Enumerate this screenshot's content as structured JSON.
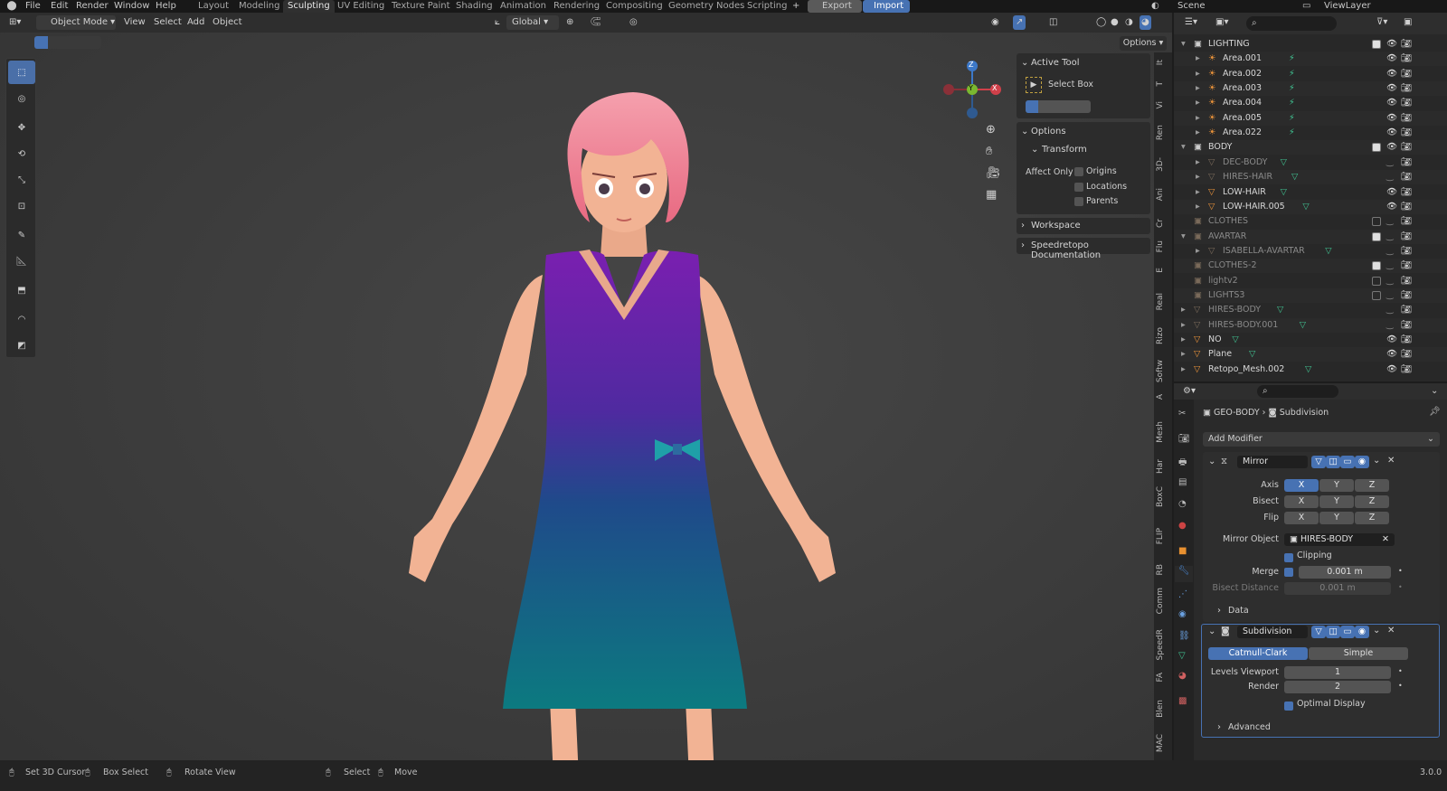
{
  "topbar": {
    "menus": [
      "File",
      "Edit",
      "Render",
      "Window",
      "Help"
    ],
    "workspaces": [
      "Layout",
      "Modeling",
      "Sculpting",
      "UV Editing",
      "Texture Paint",
      "Shading",
      "Animation",
      "Rendering",
      "Compositing",
      "Geometry Nodes",
      "Scripting"
    ],
    "active_workspace": "Sculpting",
    "add_tab": "+",
    "export_label": "Export",
    "import_label": "Import",
    "scene_label": "Scene",
    "viewlayer_label": "ViewLayer"
  },
  "viewport_header": {
    "mode": "Object Mode",
    "menus": [
      "View",
      "Select",
      "Add",
      "Object"
    ],
    "transform_orientation": "Global",
    "options_label": "Options"
  },
  "npanel": {
    "active_tool_title": "Active Tool",
    "tool_name": "Select Box",
    "options_title": "Options",
    "transform_title": "Transform",
    "affect_only_label": "Affect Only",
    "affect_options": [
      "Origins",
      "Locations",
      "Parents"
    ],
    "workspace_title": "Workspace",
    "speedretopo_title": "Speedretopo Documentation"
  },
  "sidebar_tabs": [
    "It",
    "T",
    "Vi",
    "Ren",
    "3D-",
    "Ani",
    "Cr",
    "Flu",
    "E",
    "Real",
    "Rizo",
    "Softw",
    "A",
    "Mesh",
    "Har",
    "BoxC",
    "FLIP",
    "RB",
    "Comm",
    "SpeedR",
    "FA",
    "Blen",
    "MAC"
  ],
  "gizmo": {
    "z": "Z",
    "y": "Y",
    "x": "X"
  },
  "outliner": {
    "rows": [
      {
        "name": "LIGHTING",
        "level": 1,
        "kind": "collection",
        "expanded": true,
        "checked": true,
        "visible": true
      },
      {
        "name": "Area.001",
        "level": 2,
        "kind": "light",
        "visible": true
      },
      {
        "name": "Area.002",
        "level": 2,
        "kind": "light",
        "visible": true
      },
      {
        "name": "Area.003",
        "level": 2,
        "kind": "light",
        "visible": true
      },
      {
        "name": "Area.004",
        "level": 2,
        "kind": "light",
        "visible": true
      },
      {
        "name": "Area.005",
        "level": 2,
        "kind": "light",
        "visible": true
      },
      {
        "name": "Area.022",
        "level": 2,
        "kind": "light",
        "visible": true
      },
      {
        "name": "BODY",
        "level": 1,
        "kind": "collection",
        "expanded": true,
        "checked": true,
        "visible": true
      },
      {
        "name": "DEC-BODY",
        "level": 2,
        "kind": "mesh",
        "visible": false
      },
      {
        "name": "HIRES-HAIR",
        "level": 2,
        "kind": "mesh",
        "visible": false
      },
      {
        "name": "LOW-HAIR",
        "level": 2,
        "kind": "mesh",
        "visible": true
      },
      {
        "name": "LOW-HAIR.005",
        "level": 2,
        "kind": "mesh",
        "visible": true
      },
      {
        "name": "CLOTHES",
        "level": 1,
        "kind": "collection",
        "checked": false,
        "visible": false
      },
      {
        "name": "AVARTAR",
        "level": 1,
        "kind": "collection",
        "expanded": true,
        "checked": true,
        "visible": false
      },
      {
        "name": "ISABELLA-AVARTAR",
        "level": 2,
        "kind": "mesh",
        "visible": false
      },
      {
        "name": "CLOTHES-2",
        "level": 1,
        "kind": "collection",
        "checked": true,
        "visible": false
      },
      {
        "name": "lightv2",
        "level": 1,
        "kind": "collection",
        "checked": false,
        "visible": false
      },
      {
        "name": "LIGHTS3",
        "level": 1,
        "kind": "collection",
        "checked": false,
        "visible": false
      },
      {
        "name": "HIRES-BODY",
        "level": 1,
        "kind": "mesh",
        "visible": false
      },
      {
        "name": "HIRES-BODY.001",
        "level": 1,
        "kind": "mesh",
        "visible": false
      },
      {
        "name": "NO",
        "level": 1,
        "kind": "mesh",
        "visible": true
      },
      {
        "name": "Plane",
        "level": 1,
        "kind": "mesh",
        "visible": true
      },
      {
        "name": "Retopo_Mesh.002",
        "level": 1,
        "kind": "mesh",
        "visible": true
      }
    ]
  },
  "properties": {
    "breadcrumb_object": "GEO-BODY",
    "breadcrumb_modifier": "Subdivision",
    "add_modifier": "Add Modifier",
    "mirror": {
      "name": "Mirror",
      "axis_label": "Axis",
      "bisect_label": "Bisect",
      "flip_label": "Flip",
      "axes": [
        "X",
        "Y",
        "Z"
      ],
      "mirror_object_label": "Mirror Object",
      "mirror_object": "HIRES-BODY",
      "clipping_label": "Clipping",
      "merge_label": "Merge",
      "merge_value": "0.001 m",
      "bisect_distance_label": "Bisect Distance",
      "bisect_distance_value": "0.001 m",
      "data_label": "Data"
    },
    "subdivision": {
      "name": "Subdivision",
      "method_active": "Catmull-Clark",
      "method_other": "Simple",
      "levels_viewport_label": "Levels Viewport",
      "levels_viewport": "1",
      "render_label": "Render",
      "render_value": "2",
      "optimal_display_label": "Optimal Display",
      "advanced_label": "Advanced"
    }
  },
  "statusbar": {
    "set_cursor": "Set 3D Cursor",
    "box_select": "Box Select",
    "rotate_view": "Rotate View",
    "select": "Select",
    "move": "Move",
    "version": "3.0.0"
  },
  "colors": {
    "accent": "#4772b3",
    "export_button": "#5a5a5a",
    "import_button": "#4772b3",
    "hair": "#f08a9a",
    "dress_top": "#7a1fb0",
    "dress_bottom": "#0c7a80",
    "skin": "#f2b394"
  }
}
